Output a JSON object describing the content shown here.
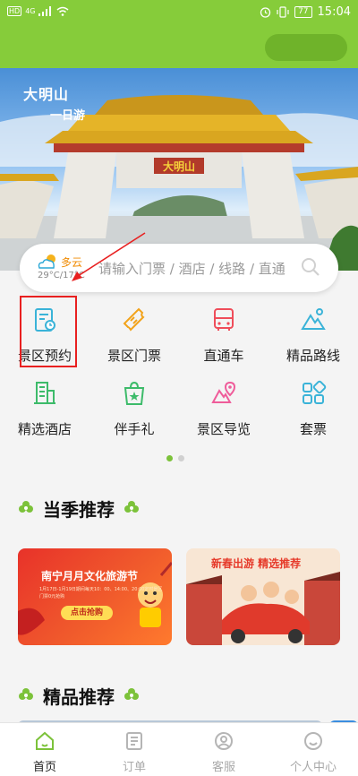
{
  "status_bar": {
    "network": "HD",
    "signal": "4G",
    "battery": "77",
    "time": "15:04"
  },
  "banner": {
    "logo_line1": "大明山",
    "logo_line2": "一日游",
    "gate_plaque": "大明山"
  },
  "search": {
    "weather_condition": "多云",
    "temperature": "29°C/17°C",
    "placeholder": "请输入门票 / 酒店 / 线路 / 直通"
  },
  "quick_menu": [
    {
      "label": "景区预约",
      "icon": "reservation-icon",
      "color": "#3ab3d8"
    },
    {
      "label": "景区门票",
      "icon": "ticket-icon",
      "color": "#f2a31b"
    },
    {
      "label": "直通车",
      "icon": "bus-icon",
      "color": "#ef4d5a"
    },
    {
      "label": "精品路线",
      "icon": "mountain-route-icon",
      "color": "#3ab3d8"
    },
    {
      "label": "精选酒店",
      "icon": "hotel-icon",
      "color": "#3dbb6a"
    },
    {
      "label": "伴手礼",
      "icon": "gift-bag-icon",
      "color": "#3dbb6a"
    },
    {
      "label": "景区导览",
      "icon": "guide-map-icon",
      "color": "#ef5c9a"
    },
    {
      "label": "套票",
      "icon": "package-grid-icon",
      "color": "#3ab3d8"
    }
  ],
  "pagination": {
    "current": 1,
    "total": 2
  },
  "sections": {
    "seasonal": {
      "title": "当季推荐"
    },
    "featured": {
      "title": "精品推荐"
    }
  },
  "seasonal_cards": [
    {
      "title": "南宁月月文化旅游节",
      "detail": "1月17日-1月19日期间每天10：00、14:00、20:00定时景区门票0元抢购",
      "button": "点击抢购"
    },
    {
      "title": "新春出游 精选推荐"
    }
  ],
  "tab_bar": [
    {
      "label": "首页",
      "icon": "home-icon",
      "active": true
    },
    {
      "label": "订单",
      "icon": "order-list-icon",
      "active": false
    },
    {
      "label": "客服",
      "icon": "customer-service-icon",
      "active": false
    },
    {
      "label": "个人中心",
      "icon": "profile-icon",
      "active": false
    }
  ],
  "colors": {
    "brand_green": "#86cc3a",
    "highlight_red": "#e82020",
    "active_dot": "#7cc23a"
  }
}
